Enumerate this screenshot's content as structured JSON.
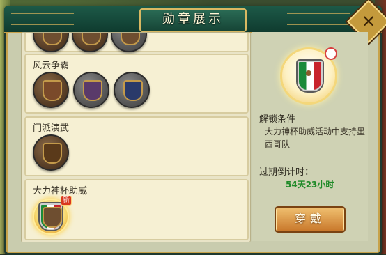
{
  "window": {
    "title": "勋章展示"
  },
  "categories": [
    {
      "title": "",
      "medal_count": 3
    },
    {
      "title": "风云争霸",
      "medal_count": 3
    },
    {
      "title": "门派演武",
      "medal_count": 1
    },
    {
      "title": "大力神杯助威",
      "medal_count": 1,
      "new_badge": "新"
    }
  ],
  "detail": {
    "unlock_heading": "解锁条件",
    "unlock_text": "大力神杯助威活动中支持墨西哥队",
    "expire_heading": "过期倒计时：",
    "countdown": "54天23小时",
    "wear_button": "穿戴"
  },
  "colors": {
    "title_bar": "#0f3b2f",
    "gold_trim": "#d9b862",
    "countdown_green": "#1f8a28",
    "button_orange": "#c8772a"
  },
  "icons": [
    "close-icon",
    "mexico-flag-shield",
    "swirl-icon"
  ]
}
